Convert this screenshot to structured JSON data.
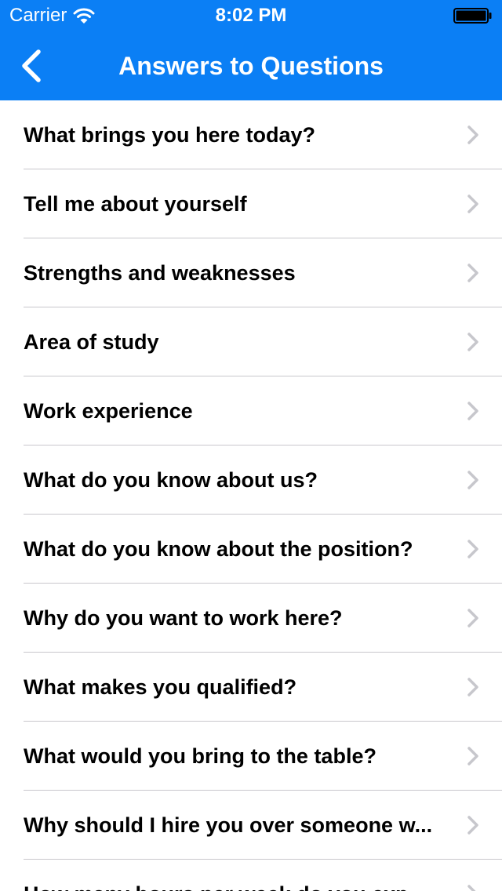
{
  "status_bar": {
    "carrier": "Carrier",
    "time": "8:02 PM",
    "wifi_icon": "wifi-icon",
    "battery_icon": "battery-icon"
  },
  "nav_bar": {
    "title": "Answers to Questions",
    "back_icon": "chevron-left-icon",
    "color": "#0b7ff5"
  },
  "list": {
    "items": [
      {
        "label": "What brings you here today?"
      },
      {
        "label": "Tell me about yourself"
      },
      {
        "label": "Strengths and weaknesses"
      },
      {
        "label": "Area of study"
      },
      {
        "label": "Work experience"
      },
      {
        "label": "What do you know about us?"
      },
      {
        "label": "What do you know about the position?"
      },
      {
        "label": "Why do you want to work here?"
      },
      {
        "label": "What makes you qualified?"
      },
      {
        "label": "What would you bring to the table?"
      },
      {
        "label": "Why should I hire you over someone w..."
      },
      {
        "label": "How many hours per week do you exp..."
      }
    ],
    "accessory_icon": "chevron-right-icon"
  }
}
